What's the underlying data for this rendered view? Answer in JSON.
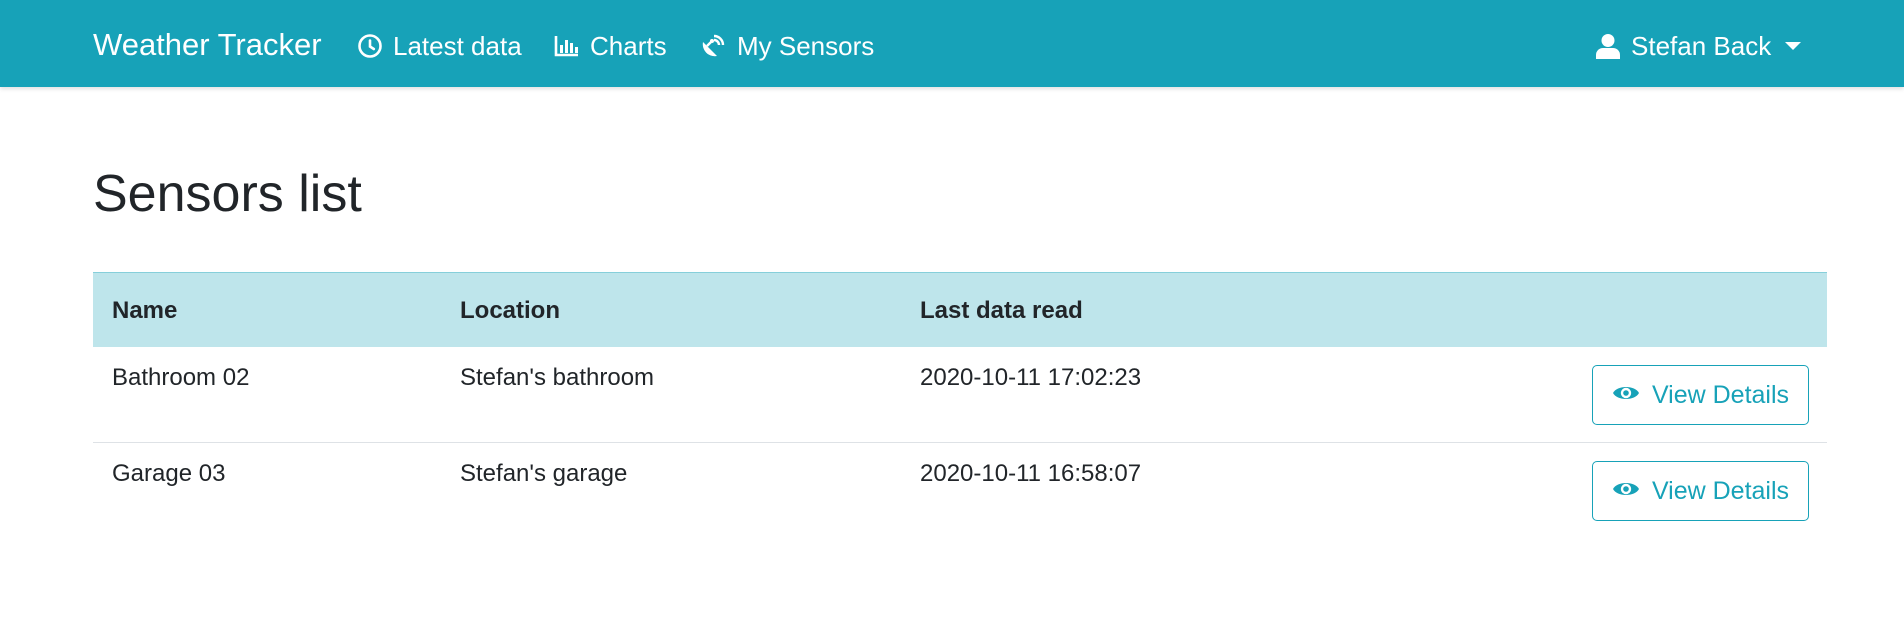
{
  "navbar": {
    "brand": "Weather Tracker",
    "items": [
      {
        "label": "Latest data",
        "icon": "clock-icon"
      },
      {
        "label": "Charts",
        "icon": "bar-chart-icon"
      },
      {
        "label": "My Sensors",
        "icon": "satellite-dish-icon"
      }
    ],
    "user": {
      "name": "Stefan Back",
      "icon": "user-icon"
    },
    "color": "#17a2b8"
  },
  "main": {
    "title": "Sensors list",
    "table": {
      "headers": [
        "Name",
        "Location",
        "Last data read",
        ""
      ],
      "header_bg": "#bee5eb",
      "rows": [
        {
          "name": "Bathroom 02",
          "location": "Stefan's bathroom",
          "last_read": "2020-10-11 17:02:23",
          "action": "View Details"
        },
        {
          "name": "Garage 03",
          "location": "Stefan's garage",
          "last_read": "2020-10-11 16:58:07",
          "action": "View Details"
        }
      ]
    }
  }
}
